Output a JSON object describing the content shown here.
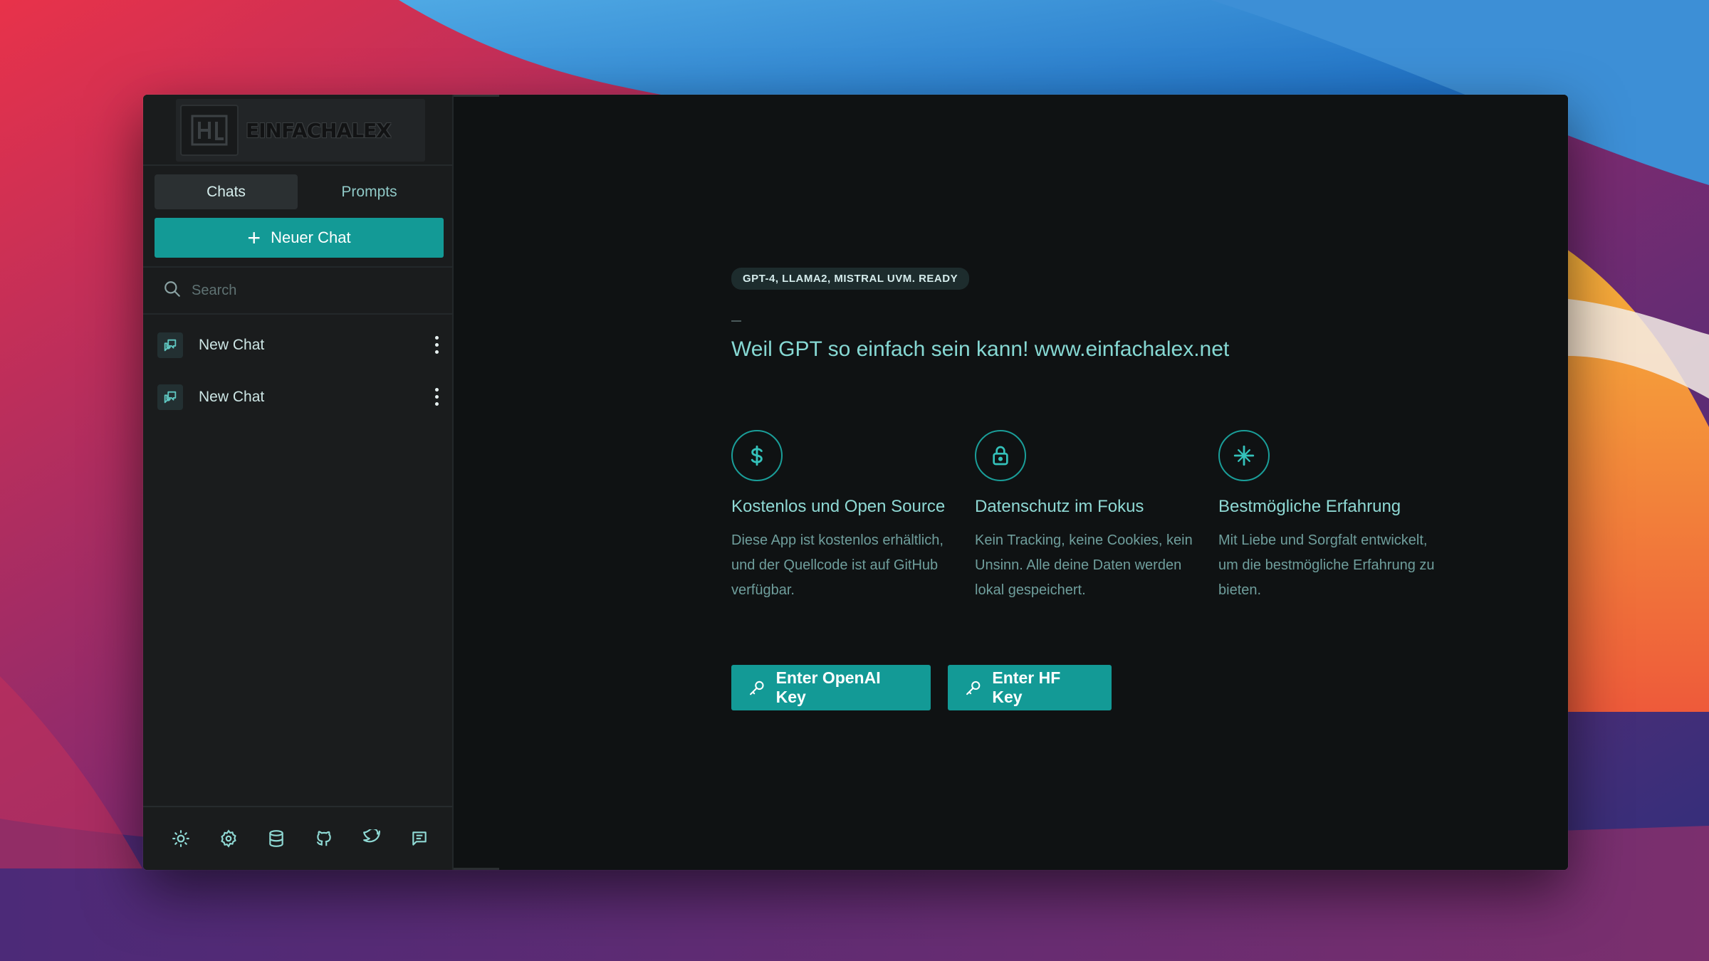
{
  "sidebar": {
    "tabs": [
      {
        "label": "Chats",
        "active": true
      },
      {
        "label": "Prompts",
        "active": false
      }
    ],
    "new_chat_label": "Neuer Chat",
    "search_placeholder": "Search",
    "chats": [
      {
        "label": "New Chat"
      },
      {
        "label": "New Chat"
      }
    ],
    "logo": {
      "text": "EINFACHALEX"
    },
    "footer_icons": [
      "sun-icon",
      "gear-icon",
      "database-icon",
      "github-icon",
      "twitter-icon",
      "message-icon"
    ]
  },
  "main": {
    "badge": "GPT-4, LLAMA2, MISTRAL UVM. READY",
    "headline": "Weil GPT so einfach sein kann! www.einfachalex.net",
    "features": [
      {
        "icon": "dollar-icon",
        "title": "Kostenlos und Open Source",
        "description": "Diese App ist kostenlos erhältlich, und der Quellcode ist auf GitHub verfügbar."
      },
      {
        "icon": "lock-icon",
        "title": "Datenschutz im Fokus",
        "description": "Kein Tracking, keine Cookies, kein Unsinn. Alle deine Daten werden lokal gespeichert."
      },
      {
        "icon": "sparkle-icon",
        "title": "Bestmögliche Erfahrung",
        "description": "Mit Liebe und Sorgfalt entwickelt, um die bestmögliche Erfahrung zu bieten."
      }
    ],
    "buttons": {
      "openai_key": "Enter OpenAI Key",
      "hf_key": "Enter HF Key"
    }
  },
  "colors": {
    "accent": "#139a96",
    "accent_text": "#86d8d3",
    "sidebar_bg": "#1a1c1d",
    "main_bg": "#0f1213"
  }
}
